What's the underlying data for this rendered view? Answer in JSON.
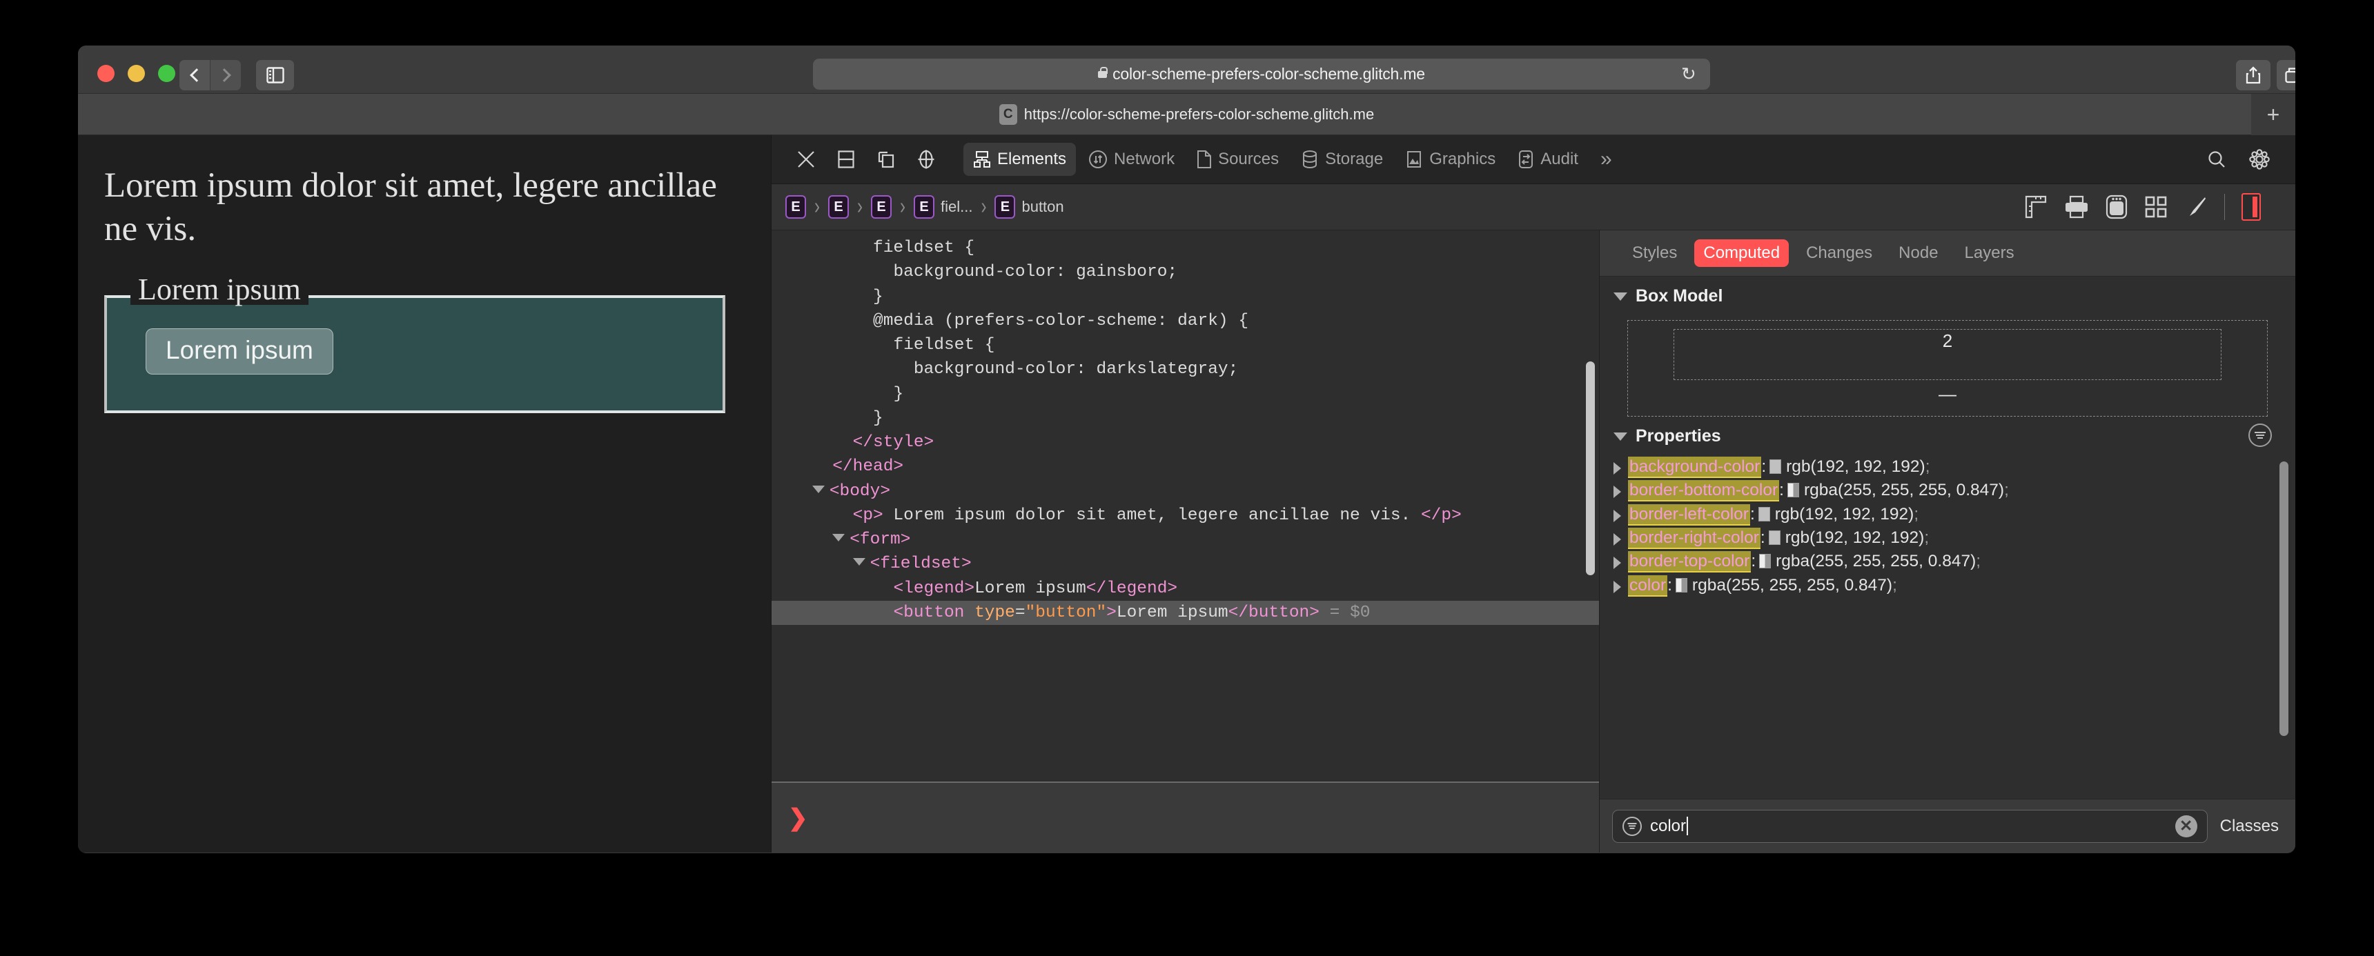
{
  "window": {
    "traffic_lights": [
      "close",
      "minimize",
      "zoom"
    ],
    "back_label": "Back",
    "forward_label": "Forward",
    "sidebar_label": "Show sidebar",
    "share_label": "Share",
    "tabs_label": "Show tab overview",
    "new_tab_label": "+"
  },
  "urlbar": {
    "url": "color-scheme-prefers-color-scheme.glitch.me",
    "reload_glyph": "↻"
  },
  "tabstrip": {
    "favicon_letter": "C",
    "title": "https://color-scheme-prefers-color-scheme.glitch.me"
  },
  "page": {
    "paragraph": "Lorem ipsum dolor sit amet, legere ancillae ne vis.",
    "legend": "Lorem ipsum",
    "button_label": "Lorem ipsum",
    "background": "#1f1f1f",
    "fieldset_background": "darkslategray",
    "text_color": "rgba(255, 255, 255, 0.847)"
  },
  "devtools": {
    "toolbar_icons": [
      "close-icon",
      "dock-bottom-icon",
      "dock-undock-icon",
      "inspect-target-icon"
    ],
    "tabs": [
      {
        "label": "Elements",
        "icon": "elements-tree-icon",
        "active": true
      },
      {
        "label": "Network",
        "icon": "network-arrows-icon",
        "active": false
      },
      {
        "label": "Sources",
        "icon": "document-icon",
        "active": false
      },
      {
        "label": "Storage",
        "icon": "database-icon",
        "active": false
      },
      {
        "label": "Graphics",
        "icon": "image-icon",
        "active": false
      },
      {
        "label": "Audit",
        "icon": "audit-icon",
        "active": false
      }
    ],
    "overflow_label": "»",
    "search_label": "Search",
    "settings_label": "Settings",
    "breadcrumb": [
      {
        "badge": "E",
        "label": ""
      },
      {
        "badge": "E",
        "label": ""
      },
      {
        "badge": "E",
        "label": ""
      },
      {
        "badge": "E",
        "label": "fiel..."
      },
      {
        "badge": "E",
        "label": "button"
      }
    ],
    "breadcrumb_separator": "›",
    "crumb_tools": [
      "ruler-icon",
      "print-icon",
      "device-icon",
      "grid-icon",
      "paintbrush-icon"
    ],
    "layout_badge_name": "layout-sidebar-toggle"
  },
  "dom": {
    "lines": [
      {
        "id": "l1",
        "indent": 5,
        "parts": [
          {
            "t": "txt",
            "v": "fieldset {"
          }
        ]
      },
      {
        "id": "l2",
        "indent": 6,
        "parts": [
          {
            "t": "txt",
            "v": "background-color: gainsboro;"
          }
        ]
      },
      {
        "id": "l3",
        "indent": 5,
        "parts": [
          {
            "t": "txt",
            "v": "}"
          }
        ]
      },
      {
        "id": "l4",
        "indent": 5,
        "parts": [
          {
            "t": "txt",
            "v": "@media (prefers-color-scheme: dark) {"
          }
        ]
      },
      {
        "id": "l5",
        "indent": 6,
        "parts": [
          {
            "t": "txt",
            "v": "fieldset {"
          }
        ]
      },
      {
        "id": "l6",
        "indent": 7,
        "parts": [
          {
            "t": "txt",
            "v": "background-color: darkslategray;"
          }
        ]
      },
      {
        "id": "l7",
        "indent": 6,
        "parts": [
          {
            "t": "txt",
            "v": "}"
          }
        ]
      },
      {
        "id": "l8",
        "indent": 5,
        "parts": [
          {
            "t": "txt",
            "v": "}"
          }
        ]
      },
      {
        "id": "l9",
        "indent": 4,
        "parts": [
          {
            "t": "tag",
            "v": "</style>"
          }
        ]
      },
      {
        "id": "l10",
        "indent": 3,
        "parts": [
          {
            "t": "tag",
            "v": "</head>"
          }
        ]
      },
      {
        "id": "l11",
        "indent": 2,
        "tri": true,
        "parts": [
          {
            "t": "tag",
            "v": "<body>"
          }
        ]
      },
      {
        "id": "l12",
        "indent": 4,
        "parts": [
          {
            "t": "tag",
            "v": "<p>"
          },
          {
            "t": "txt",
            "v": " Lorem ipsum dolor sit amet, legere ancillae ne vis. "
          },
          {
            "t": "tag",
            "v": "</p>"
          }
        ]
      },
      {
        "id": "l13",
        "indent": 3,
        "tri": true,
        "parts": [
          {
            "t": "tag",
            "v": "<form>"
          }
        ]
      },
      {
        "id": "l14",
        "indent": 4,
        "tri": true,
        "parts": [
          {
            "t": "tag",
            "v": "<fieldset>"
          }
        ]
      },
      {
        "id": "l15",
        "indent": 6,
        "parts": [
          {
            "t": "tag",
            "v": "<legend>"
          },
          {
            "t": "txt",
            "v": "Lorem ipsum"
          },
          {
            "t": "tag",
            "v": "</legend>"
          }
        ]
      },
      {
        "id": "l16",
        "indent": 6,
        "selected": true,
        "parts": [
          {
            "t": "tag",
            "v": "<button "
          },
          {
            "t": "attr",
            "v": "type"
          },
          {
            "t": "txt",
            "v": "="
          },
          {
            "t": "attrv",
            "v": "\"button\""
          },
          {
            "t": "tag",
            "v": ">"
          },
          {
            "t": "txt",
            "v": "Lorem ipsum"
          },
          {
            "t": "tag",
            "v": "</button>"
          },
          {
            "t": "dim",
            "v": " = $0"
          }
        ]
      }
    ],
    "console_prompt": "❯"
  },
  "styles_panel": {
    "tabs": [
      {
        "label": "Styles",
        "active": false
      },
      {
        "label": "Computed",
        "active": true
      },
      {
        "label": "Changes",
        "active": false
      },
      {
        "label": "Node",
        "active": false
      },
      {
        "label": "Layers",
        "active": false
      }
    ],
    "box_model": {
      "title": "Box Model",
      "top_value": "2",
      "bottom_value": "—"
    },
    "properties_title": "Properties",
    "properties": [
      {
        "name": "background-color",
        "swatch": "gray",
        "value": "rgb(192, 192, 192)"
      },
      {
        "name": "border-bottom-color",
        "swatch": "white",
        "value": "rgba(255, 255, 255, 0.847)"
      },
      {
        "name": "border-left-color",
        "swatch": "gray",
        "value": "rgb(192, 192, 192)"
      },
      {
        "name": "border-right-color",
        "swatch": "gray",
        "value": "rgb(192, 192, 192)"
      },
      {
        "name": "border-top-color",
        "swatch": "white",
        "value": "rgba(255, 255, 255, 0.847)"
      },
      {
        "name": "color",
        "swatch": "white",
        "value": "rgba(255, 255, 255, 0.847)"
      }
    ],
    "filter": {
      "value": "color",
      "placeholder": "Filter",
      "clear_glyph": "✕"
    },
    "classes_label": "Classes"
  },
  "colors": {
    "accent_red": "#ff5252",
    "highlight_yellow": "#a59a33",
    "property_pink": "#f49ad8",
    "tag_pink": "#f093d3",
    "attr_orange": "#ffaf6b"
  }
}
